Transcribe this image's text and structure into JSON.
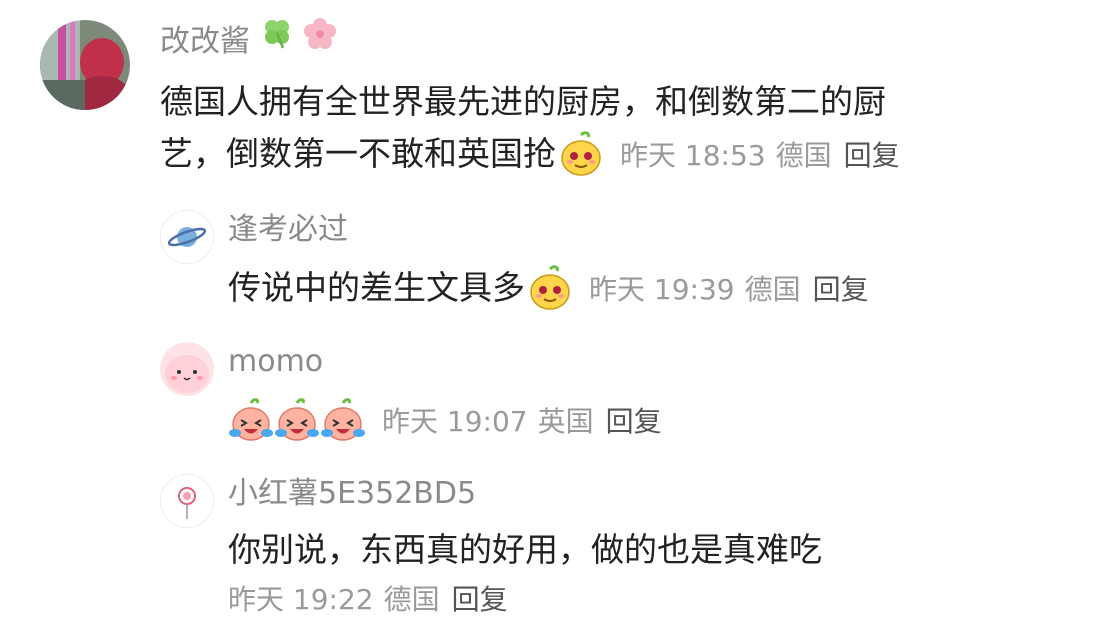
{
  "comments": [
    {
      "username": "改改酱",
      "username_icons": [
        "four-leaf-clover-icon",
        "cherry-blossom-icon"
      ],
      "text_line1": "德国人拥有全世界最先进的厨房，和倒数第二的厨",
      "text_line2": "艺，倒数第一不敢和英国抢",
      "emoji": "smirk-potato-emoji",
      "time": "昨天 18:53",
      "location": "德国",
      "reply_label": "回复"
    },
    {
      "username": "逢考必过",
      "text": "传说中的差生文具多",
      "emoji": "smirk-potato-emoji",
      "time": "昨天 19:39",
      "location": "德国",
      "reply_label": "回复"
    },
    {
      "username": "momo",
      "emojis": [
        "crying-laughing-peach-emoji",
        "crying-laughing-peach-emoji",
        "crying-laughing-peach-emoji"
      ],
      "time": "昨天 19:07",
      "location": "英国",
      "reply_label": "回复"
    },
    {
      "username": "小红薯5E352BD5",
      "text": "你别说，东西真的好用，做的也是真难吃",
      "time": "昨天 19:22",
      "location": "德国",
      "reply_label": "回复"
    }
  ],
  "colors": {
    "username": "#8a8a8a",
    "text": "#222222",
    "meta": "#9a9a9a",
    "reply": "#555555"
  }
}
